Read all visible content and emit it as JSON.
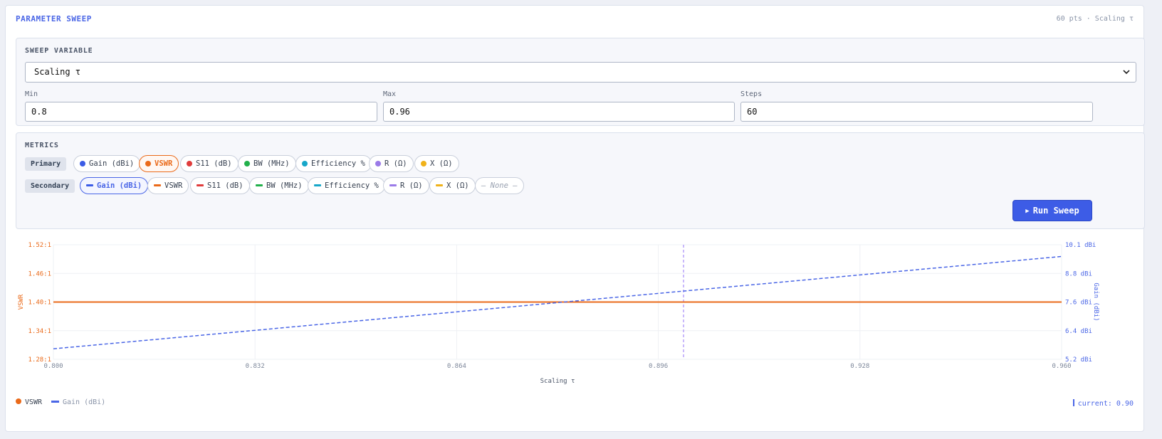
{
  "header": {
    "title": "PARAMETER SWEEP",
    "meta": "60 pts · Scaling τ"
  },
  "sweep": {
    "section_label": "SWEEP VARIABLE",
    "selected": "Scaling τ",
    "min_label": "Min",
    "min_value": "0.8",
    "max_label": "Max",
    "max_value": "0.96",
    "steps_label": "Steps",
    "steps_value": "60"
  },
  "metrics": {
    "section_label": "METRICS",
    "primary_label": "Primary",
    "secondary_label": "Secondary",
    "primary": [
      {
        "label": "Gain (dBi)",
        "color": "#3b5ce6",
        "selected": false
      },
      {
        "label": "VSWR",
        "color": "#ea6a1a",
        "selected": true
      },
      {
        "label": "S11 (dB)",
        "color": "#e03c3c",
        "selected": false
      },
      {
        "label": "BW (MHz)",
        "color": "#22b04b",
        "selected": false
      },
      {
        "label": "Efficiency %",
        "color": "#17a7c9",
        "selected": false
      },
      {
        "label": "R (Ω)",
        "color": "#9b7be8",
        "selected": false
      },
      {
        "label": "X (Ω)",
        "color": "#f0b21a",
        "selected": false
      }
    ],
    "secondary": [
      {
        "label": "Gain (dBi)",
        "color": "#3b5ce6",
        "selected": true
      },
      {
        "label": "VSWR",
        "color": "#ea6a1a",
        "selected": false
      },
      {
        "label": "S11 (dB)",
        "color": "#e03c3c",
        "selected": false
      },
      {
        "label": "BW (MHz)",
        "color": "#22b04b",
        "selected": false
      },
      {
        "label": "Efficiency %",
        "color": "#17a7c9",
        "selected": false
      },
      {
        "label": "R (Ω)",
        "color": "#9b7be8",
        "selected": false
      },
      {
        "label": "X (Ω)",
        "color": "#f0b21a",
        "selected": false
      },
      {
        "label": "— None —",
        "color": "",
        "selected": false
      }
    ],
    "run_label": "Run Sweep"
  },
  "chart_data": {
    "type": "line",
    "xlabel": "Scaling τ",
    "ylabel_left": "VSWR",
    "ylabel_right": "Gain (dBi)",
    "xlim": [
      0.8,
      0.96
    ],
    "x_ticks": [
      "0.800",
      "0.832",
      "0.864",
      "0.896",
      "0.928",
      "0.960"
    ],
    "y_left_lim": [
      1.28,
      1.52
    ],
    "y_left_ticks": [
      "1.28:1",
      "1.34:1",
      "1.40:1",
      "1.46:1",
      "1.52:1"
    ],
    "y_right_lim": [
      5.2,
      10.1
    ],
    "y_right_ticks": [
      "5.2 dBi",
      "6.4 dBi",
      "7.6 dBi",
      "8.8 dBi",
      "10.1 dBi"
    ],
    "series": [
      {
        "name": "VSWR",
        "axis": "left",
        "color": "#ea6a1a",
        "style": "solid",
        "x": [
          0.8,
          0.96
        ],
        "y": [
          1.4,
          1.4
        ]
      },
      {
        "name": "Gain (dBi)",
        "axis": "right",
        "color": "#4a66e6",
        "style": "dashed",
        "x": [
          0.8,
          0.96
        ],
        "y": [
          5.65,
          9.6
        ]
      }
    ],
    "marker_x": 0.9,
    "grid": true
  },
  "footer": {
    "legend_primary": "VSWR",
    "legend_secondary": "Gain (dBi)",
    "current": "current: 0.90"
  }
}
